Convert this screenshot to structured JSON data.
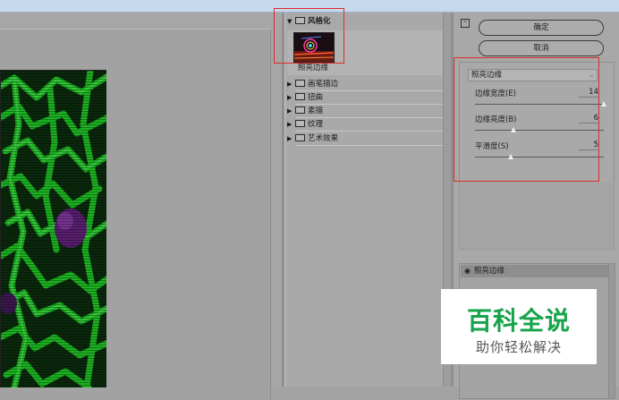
{
  "gallery": {
    "expanded_category": "风格化",
    "selected_filter_label": "照亮边缘",
    "categories": [
      "画笔描边",
      "扭曲",
      "素描",
      "纹理",
      "艺术效果"
    ]
  },
  "settings": {
    "ok_label": "确定",
    "cancel_label": "取消",
    "filter_selected": "照亮边缘",
    "params": [
      {
        "label": "边缘宽度(E)",
        "value": "14",
        "fraction": 1.0
      },
      {
        "label": "边缘亮度(B)",
        "value": "6",
        "fraction": 0.3
      },
      {
        "label": "平滑度(S)",
        "value": "5",
        "fraction": 0.28
      }
    ]
  },
  "layers": {
    "effect_layer_label": "照亮边缘"
  },
  "watermark": {
    "title": "百科全说",
    "subtitle": "助你轻松解决"
  },
  "colors": {
    "highlight": "#e02a2a",
    "preview_green": "#22c22a",
    "preview_purple": "#6a2a86",
    "watermark_green": "#16a34a"
  }
}
